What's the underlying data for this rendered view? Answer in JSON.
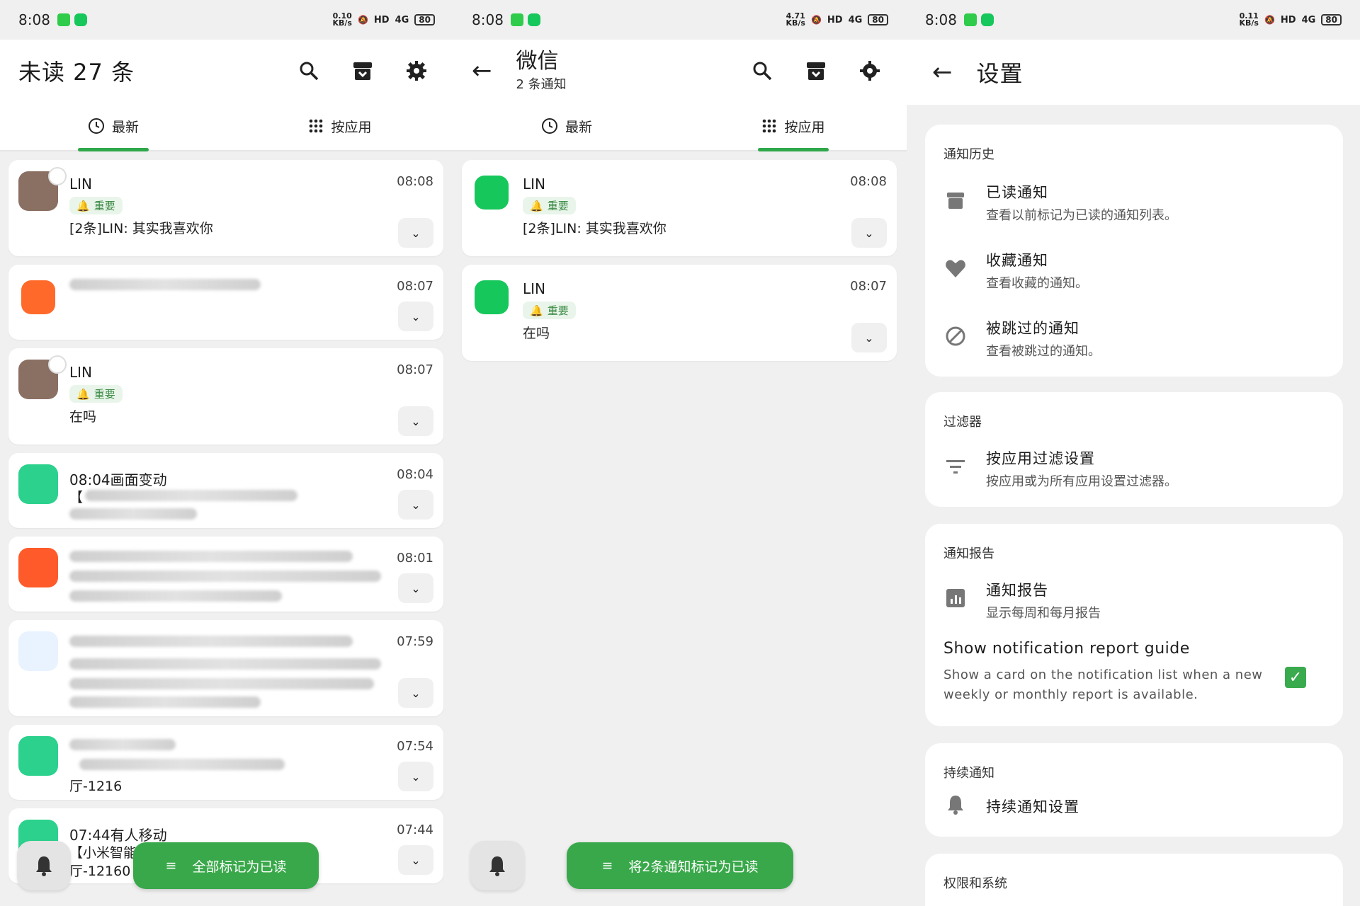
{
  "status": {
    "time": "8:08",
    "net1": "0.10\nKB/s",
    "net2": "4.71\nKB/s",
    "net3": "0.11\nKB/s",
    "battery": "80",
    "hd": "HD",
    "signal": "4G"
  },
  "panel1": {
    "title": "未读 27 条",
    "tabs": [
      "最新",
      "按应用"
    ],
    "cards": [
      {
        "name": "LIN",
        "time": "08:08",
        "chip": "重要",
        "msg": "[2条]LIN: 其实我喜欢你"
      },
      {
        "name": "",
        "time": "08:07"
      },
      {
        "name": "LIN",
        "time": "08:07",
        "chip": "重要",
        "msg": "在吗"
      },
      {
        "name": "08:04画面变动",
        "time": "08:04",
        "msg": "【"
      },
      {
        "name": "",
        "time": "08:01"
      },
      {
        "name": "",
        "time": "07:59"
      },
      {
        "name": "",
        "time": "07:54",
        "msg": "厅-1216"
      },
      {
        "name": "07:44有人移动",
        "time": "07:44",
        "msg": "【小米智能摄像机3 云台版 2 客",
        "msg2": "厅-12160"
      }
    ],
    "mark_all": "全部标记为已读"
  },
  "panel2": {
    "title": "微信",
    "subtitle": "2 条通知",
    "tabs": [
      "最新",
      "按应用"
    ],
    "cards": [
      {
        "name": "LIN",
        "time": "08:08",
        "chip": "重要",
        "msg": "[2条]LIN: 其实我喜欢你"
      },
      {
        "name": "LIN",
        "time": "08:07",
        "chip": "重要",
        "msg": "在吗"
      }
    ],
    "mark_btn": "将2条通知标记为已读"
  },
  "panel3": {
    "title": "设置",
    "sections": {
      "history": "通知历史",
      "filter": "过滤器",
      "report": "通知报告",
      "ongoing": "持续通知",
      "perm": "权限和系统"
    },
    "rows": {
      "read": {
        "title": "已读通知",
        "sub": "查看以前标记为已读的通知列表。"
      },
      "fav": {
        "title": "收藏通知",
        "sub": "查看收藏的通知。"
      },
      "skipped": {
        "title": "被跳过的通知",
        "sub": "查看被跳过的通知。"
      },
      "appfilter": {
        "title": "按应用过滤设置",
        "sub": "按应用或为所有应用设置过滤器。"
      },
      "report": {
        "title": "通知报告",
        "sub": "显示每周和每月报告"
      },
      "guide": {
        "title": "Show notification report guide",
        "sub": "Show a card on the notification list when a new weekly or monthly report is available.",
        "checked": true
      },
      "ongoing": {
        "title": "持续通知设置"
      }
    }
  },
  "colors": {
    "accent": "#39a84a",
    "chip_bg": "#e9f5ea",
    "wechat": "#16c75b"
  }
}
